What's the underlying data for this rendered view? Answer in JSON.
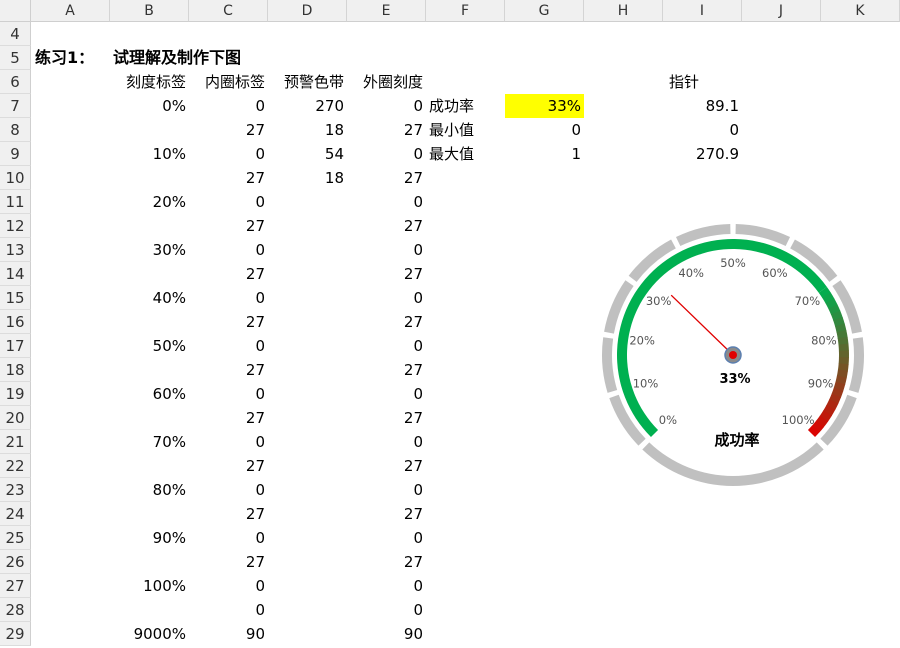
{
  "columns": [
    "A",
    "B",
    "C",
    "D",
    "E",
    "F",
    "G",
    "H",
    "I",
    "J",
    "K"
  ],
  "rows": [
    "4",
    "5",
    "6",
    "7",
    "8",
    "9",
    "10",
    "11",
    "12",
    "13",
    "14",
    "15",
    "16",
    "17",
    "18",
    "19",
    "20",
    "21",
    "22",
    "23",
    "24",
    "25",
    "26",
    "27",
    "28",
    "29"
  ],
  "title": {
    "label": "练习1：",
    "text": "试理解及制作下图"
  },
  "headers": {
    "b": "刻度标签",
    "c": "内圈标签",
    "d": "预警色带",
    "e": "外圈刻度",
    "i": "指针"
  },
  "table": {
    "b": [
      "0%",
      "",
      "10%",
      "",
      "20%",
      "",
      "30%",
      "",
      "40%",
      "",
      "50%",
      "",
      "60%",
      "",
      "70%",
      "",
      "80%",
      "",
      "90%",
      "",
      "100%",
      "",
      "9000%"
    ],
    "c": [
      "0",
      "27",
      "0",
      "27",
      "0",
      "27",
      "0",
      "27",
      "0",
      "27",
      "0",
      "27",
      "0",
      "27",
      "0",
      "27",
      "0",
      "27",
      "0",
      "27",
      "0",
      "0",
      "90"
    ],
    "d": [
      "270",
      "18",
      "54",
      "18"
    ],
    "e": [
      "0",
      "27",
      "0",
      "27",
      "0",
      "27",
      "0",
      "27",
      "0",
      "27",
      "0",
      "27",
      "0",
      "27",
      "0",
      "27",
      "0",
      "27",
      "0",
      "27",
      "0",
      "0",
      "90"
    ]
  },
  "params": {
    "f": [
      "成功率",
      "最小值",
      "最大值"
    ],
    "g": [
      "33%",
      "0",
      "1"
    ],
    "i": [
      "89.1",
      "0",
      "270.9"
    ]
  },
  "colors": {
    "highlight": "#ffff00",
    "band_green": "#00b050",
    "band_red": "#e00000",
    "outer_ring": "#c0c0c0",
    "needle": "#e00000"
  },
  "gauge": {
    "value": 0.33,
    "center_text": "33%",
    "caption": "成功率",
    "tick_labels": [
      "0%",
      "10%",
      "20%",
      "30%",
      "40%",
      "50%",
      "60%",
      "70%",
      "80%",
      "90%",
      "100%"
    ]
  }
}
